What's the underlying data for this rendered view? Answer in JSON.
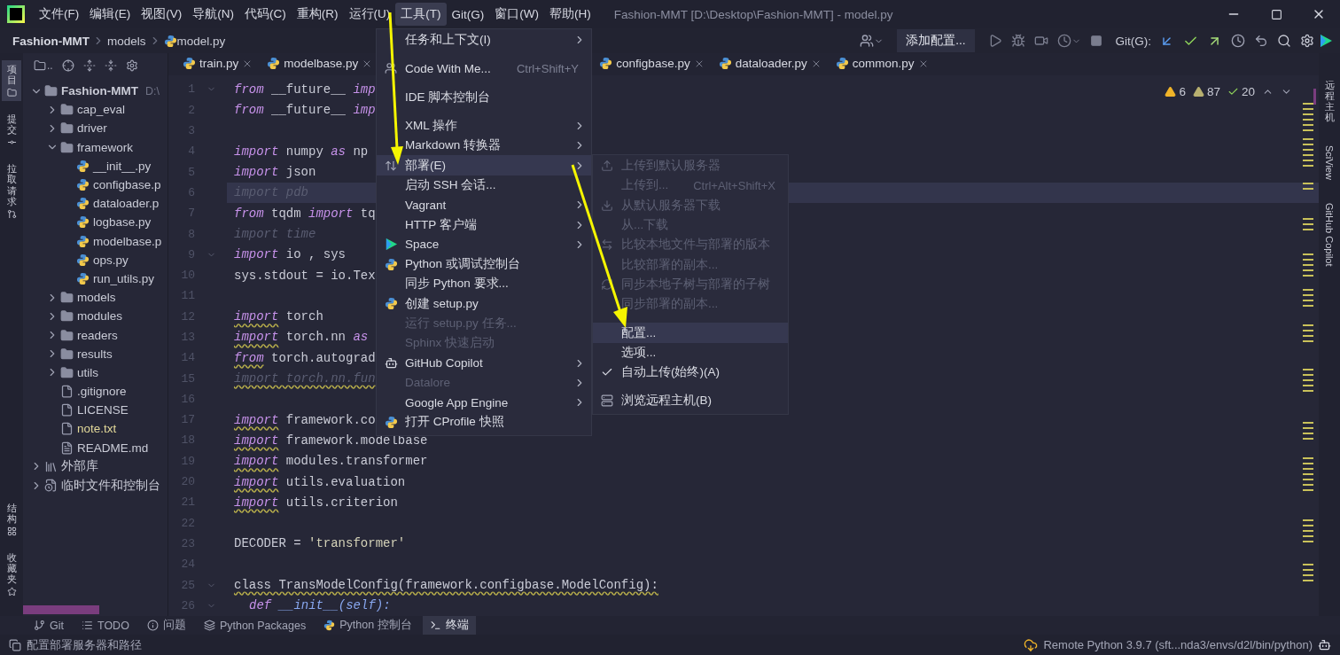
{
  "window": {
    "title": "Fashion-MMT [D:\\Desktop\\Fashion-MMT] - model.py"
  },
  "menubar": [
    {
      "label": "文件(F)",
      "selected": false
    },
    {
      "label": "编辑(E)",
      "selected": false
    },
    {
      "label": "视图(V)",
      "selected": false
    },
    {
      "label": "导航(N)",
      "selected": false
    },
    {
      "label": "代码(C)",
      "selected": false
    },
    {
      "label": "重构(R)",
      "selected": false
    },
    {
      "label": "运行(U)",
      "selected": false
    },
    {
      "label": "工具(T)",
      "selected": true
    },
    {
      "label": "Git(G)",
      "selected": false
    },
    {
      "label": "窗口(W)",
      "selected": false
    },
    {
      "label": "帮助(H)",
      "selected": false
    }
  ],
  "breadcrumbs": [
    "Fashion-MMT",
    "models",
    "model.py"
  ],
  "toolbar": {
    "run_config": "添加配置...",
    "git_label": "Git(G):"
  },
  "left_stripe": [
    {
      "label": "项目",
      "selected": true
    },
    {
      "label": "提交",
      "selected": false
    },
    {
      "label": "拉取请求",
      "selected": false
    },
    {
      "label": "结构",
      "selected": false
    },
    {
      "label": "收藏夹",
      "selected": false
    }
  ],
  "right_stripe": [
    {
      "label": "远程主机"
    },
    {
      "label": "SciView"
    },
    {
      "label": "GitHub Copilot"
    }
  ],
  "project": {
    "view": "..",
    "tree": [
      {
        "label": "Fashion-MMT",
        "kind": "project",
        "hint": "D:\\",
        "expanded": true,
        "color": "#c9cbd6",
        "children": [
          {
            "label": "cap_eval",
            "kind": "folder",
            "expanded": false,
            "color": "#c9cbd6"
          },
          {
            "label": "driver",
            "kind": "folder",
            "expanded": false,
            "color": "#c9cbd6"
          },
          {
            "label": "framework",
            "kind": "folder",
            "expanded": true,
            "color": "#c9cbd6",
            "children": [
              {
                "label": "__init__.py",
                "kind": "python",
                "color": "#c9cbd6"
              },
              {
                "label": "configbase.p",
                "kind": "python",
                "color": "#c9cbd6"
              },
              {
                "label": "dataloader.p",
                "kind": "python",
                "color": "#c9cbd6"
              },
              {
                "label": "logbase.py",
                "kind": "python",
                "color": "#c9cbd6"
              },
              {
                "label": "modelbase.p",
                "kind": "python",
                "color": "#c9cbd6"
              },
              {
                "label": "ops.py",
                "kind": "python",
                "color": "#c9cbd6"
              },
              {
                "label": "run_utils.py",
                "kind": "python",
                "color": "#c9cbd6"
              }
            ]
          },
          {
            "label": "models",
            "kind": "folder",
            "expanded": false,
            "color": "#c9cbd6"
          },
          {
            "label": "modules",
            "kind": "folder",
            "expanded": false,
            "color": "#c9cbd6"
          },
          {
            "label": "readers",
            "kind": "folder",
            "expanded": false,
            "color": "#c9cbd6"
          },
          {
            "label": "results",
            "kind": "folder",
            "expanded": false,
            "color": "#c9cbd6"
          },
          {
            "label": "utils",
            "kind": "folder",
            "expanded": false,
            "color": "#c9cbd6"
          },
          {
            "label": ".gitignore",
            "kind": "file",
            "color": "#c9cbd6"
          },
          {
            "label": "LICENSE",
            "kind": "file",
            "color": "#c9cbd6"
          },
          {
            "label": "note.txt",
            "kind": "file",
            "color": "#e3d99a"
          },
          {
            "label": "README.md",
            "kind": "markdown",
            "color": "#c9cbd6"
          }
        ]
      },
      {
        "label": "外部库",
        "kind": "library",
        "expanded": false,
        "color": "#c9cbd6"
      },
      {
        "label": "临时文件和控制台",
        "kind": "scratch",
        "expanded": false,
        "color": "#c9cbd6"
      }
    ]
  },
  "tabs": [
    {
      "label": "train.py",
      "selected": false
    },
    {
      "label": "modelbase.py",
      "selected": false
    },
    {
      "label": "configbase.py",
      "selected": false
    },
    {
      "label": "dataloader.py",
      "selected": false
    },
    {
      "label": "common.py",
      "selected": false
    }
  ],
  "inspections": {
    "warnings": "6",
    "weak_warnings": "87",
    "typos": "20"
  },
  "code": [
    {
      "number": "1",
      "current": false,
      "fold_marker": true,
      "tokens": [
        {
          "text": "from",
          "kind": "keyword",
          "squiggle": false
        },
        {
          "text": "__future__",
          "kind": "name",
          "squiggle": false
        },
        {
          "text": "imp",
          "kind": "keyword",
          "squiggle": false
        }
      ]
    },
    {
      "number": "2",
      "current": false,
      "fold_marker": false,
      "tokens": [
        {
          "text": "from",
          "kind": "keyword",
          "squiggle": false
        },
        {
          "text": "__future__",
          "kind": "name",
          "squiggle": false
        },
        {
          "text": "imp",
          "kind": "keyword",
          "squiggle": false
        }
      ]
    },
    {
      "number": "3",
      "current": false,
      "fold_marker": false
    },
    {
      "number": "4",
      "current": false,
      "fold_marker": false,
      "tokens": [
        {
          "text": "import",
          "kind": "keyword",
          "squiggle": false
        },
        {
          "text": "numpy",
          "kind": "name",
          "squiggle": false
        },
        {
          "text": "as",
          "kind": "keyword",
          "squiggle": false
        },
        {
          "text": "np",
          "kind": "name",
          "squiggle": false
        }
      ]
    },
    {
      "number": "5",
      "current": false,
      "fold_marker": false,
      "tokens": [
        {
          "text": "import",
          "kind": "keyword",
          "squiggle": false
        },
        {
          "text": "json",
          "kind": "name",
          "squiggle": false
        }
      ]
    },
    {
      "number": "6",
      "current": true,
      "fold_marker": false,
      "tokens": [
        {
          "text": "import pdb",
          "kind": "unused",
          "squiggle": false
        }
      ]
    },
    {
      "number": "7",
      "current": false,
      "fold_marker": false,
      "tokens": [
        {
          "text": "from",
          "kind": "keyword",
          "squiggle": false
        },
        {
          "text": "tqdm",
          "kind": "name",
          "squiggle": false
        },
        {
          "text": "import",
          "kind": "keyword",
          "squiggle": false
        },
        {
          "text": "tq",
          "kind": "name",
          "squiggle": false
        }
      ]
    },
    {
      "number": "8",
      "current": false,
      "fold_marker": false,
      "tokens": [
        {
          "text": "import time",
          "kind": "unused",
          "squiggle": false
        }
      ]
    },
    {
      "number": "9",
      "current": false,
      "fold_marker": true,
      "tokens": [
        {
          "text": "import",
          "kind": "keyword",
          "squiggle": false
        },
        {
          "text": "io , sys",
          "kind": "name",
          "squiggle": false
        }
      ]
    },
    {
      "number": "10",
      "current": false,
      "fold_marker": false,
      "tokens": [
        {
          "text": "sys.stdout = io.Tex",
          "kind": "name",
          "squiggle": false
        }
      ]
    },
    {
      "number": "11",
      "current": false,
      "fold_marker": false
    },
    {
      "number": "12",
      "current": false,
      "fold_marker": false,
      "tokens": [
        {
          "text": "import",
          "kind": "keyword",
          "squiggle": true
        },
        {
          "text": "torch",
          "kind": "name",
          "squiggle": false
        }
      ]
    },
    {
      "number": "13",
      "current": false,
      "fold_marker": false,
      "tokens": [
        {
          "text": "import",
          "kind": "keyword",
          "squiggle": true
        },
        {
          "text": "torch.nn",
          "kind": "name",
          "squiggle": false
        },
        {
          "text": "as",
          "kind": "keyword",
          "squiggle": false
        }
      ]
    },
    {
      "number": "14",
      "current": false,
      "fold_marker": false,
      "tokens": [
        {
          "text": "from",
          "kind": "keyword",
          "squiggle": true
        },
        {
          "text": "torch.autograd",
          "kind": "name",
          "squiggle": false
        }
      ]
    },
    {
      "number": "15",
      "current": false,
      "fold_marker": false,
      "tokens": [
        {
          "text": "import torch.nn.fun",
          "kind": "unused",
          "squiggle": true
        }
      ]
    },
    {
      "number": "16",
      "current": false,
      "fold_marker": false
    },
    {
      "number": "17",
      "current": false,
      "fold_marker": false,
      "tokens": [
        {
          "text": "import",
          "kind": "keyword",
          "squiggle": true
        },
        {
          "text": "framework.co",
          "kind": "name",
          "squiggle": false
        }
      ]
    },
    {
      "number": "18",
      "current": false,
      "fold_marker": false,
      "tokens": [
        {
          "text": "import",
          "kind": "keyword",
          "squiggle": true
        },
        {
          "text": "framework.modelbase",
          "kind": "name",
          "squiggle": false
        }
      ]
    },
    {
      "number": "19",
      "current": false,
      "fold_marker": false,
      "tokens": [
        {
          "text": "import",
          "kind": "keyword",
          "squiggle": true
        },
        {
          "text": "modules.transformer",
          "kind": "name",
          "squiggle": false
        }
      ]
    },
    {
      "number": "20",
      "current": false,
      "fold_marker": false,
      "tokens": [
        {
          "text": "import",
          "kind": "keyword",
          "squiggle": true
        },
        {
          "text": "utils.evaluation",
          "kind": "name",
          "squiggle": false
        }
      ]
    },
    {
      "number": "21",
      "current": false,
      "fold_marker": false,
      "tokens": [
        {
          "text": "import",
          "kind": "keyword",
          "squiggle": true
        },
        {
          "text": "utils.criterion",
          "kind": "name",
          "squiggle": false
        }
      ]
    },
    {
      "number": "22",
      "current": false,
      "fold_marker": false
    },
    {
      "number": "23",
      "current": false,
      "fold_marker": false,
      "tokens": [
        {
          "text": "DECODER =",
          "kind": "name",
          "squiggle": false
        },
        {
          "text": "'transformer'",
          "kind": "string",
          "squiggle": false
        }
      ]
    },
    {
      "number": "24",
      "current": false,
      "fold_marker": false
    },
    {
      "number": "25",
      "current": false,
      "fold_marker": true,
      "tokens": [
        {
          "text": "class TransModelConfig(framework.configbase.ModelConfig):",
          "kind": "name",
          "squiggle": true
        }
      ],
      "children": [
        {
          "number": "26",
          "current": false,
          "fold_marker": true,
          "tokens": [
            {
              "text": "def",
              "kind": "keyword",
              "squiggle": false
            },
            {
              "text": "__init__(self):",
              "kind": "call",
              "squiggle": false
            }
          ]
        }
      ]
    }
  ],
  "menu": [
    {
      "kind": "item",
      "label": "任务和上下文(I)",
      "submenu": true,
      "disabled": false,
      "selected": false
    },
    {
      "kind": "separator"
    },
    {
      "kind": "item",
      "label": "Code With Me...",
      "shortcut": "Ctrl+Shift+Y",
      "submenu": false,
      "disabled": false,
      "selected": false
    },
    {
      "kind": "separator"
    },
    {
      "kind": "item",
      "label": "IDE 脚本控制台",
      "submenu": false,
      "disabled": false,
      "selected": false
    },
    {
      "kind": "separator"
    },
    {
      "kind": "item",
      "label": "XML 操作",
      "submenu": true,
      "disabled": false,
      "selected": false
    },
    {
      "kind": "item",
      "label": "Markdown 转换器",
      "submenu": true,
      "disabled": false,
      "selected": false
    },
    {
      "kind": "item",
      "label": "部署(E)",
      "submenu": true,
      "disabled": false,
      "selected": true
    },
    {
      "kind": "item",
      "label": "启动 SSH 会话...",
      "submenu": false,
      "disabled": false,
      "selected": false
    },
    {
      "kind": "item",
      "label": "Vagrant",
      "submenu": true,
      "disabled": false,
      "selected": false
    },
    {
      "kind": "item",
      "label": "HTTP 客户端",
      "submenu": true,
      "disabled": false,
      "selected": false
    },
    {
      "kind": "item",
      "label": "Space",
      "submenu": true,
      "disabled": false,
      "selected": false
    },
    {
      "kind": "item",
      "label": "Python 或调试控制台",
      "submenu": false,
      "disabled": false,
      "selected": false
    },
    {
      "kind": "item",
      "label": "同步 Python 要求...",
      "submenu": false,
      "disabled": false,
      "selected": false
    },
    {
      "kind": "item",
      "label": "创建 setup.py",
      "submenu": false,
      "disabled": false,
      "selected": false
    },
    {
      "kind": "item",
      "label": "运行 setup.py 任务...",
      "submenu": false,
      "disabled": true,
      "selected": false
    },
    {
      "kind": "item",
      "label": "Sphinx 快速启动",
      "submenu": false,
      "disabled": true,
      "selected": false
    },
    {
      "kind": "item",
      "label": "GitHub Copilot",
      "submenu": true,
      "disabled": false,
      "selected": false
    },
    {
      "kind": "item",
      "label": "Datalore",
      "submenu": true,
      "disabled": true,
      "selected": false
    },
    {
      "kind": "item",
      "label": "Google App Engine",
      "submenu": true,
      "disabled": false,
      "selected": false
    },
    {
      "kind": "item",
      "label": "打开 CProfile 快照",
      "submenu": false,
      "disabled": false,
      "selected": false
    }
  ],
  "submenu": [
    {
      "kind": "item",
      "label": "上传到默认服务器",
      "disabled": true,
      "selected": false,
      "checked": false
    },
    {
      "kind": "item",
      "label": "上传到...",
      "shortcut": "Ctrl+Alt+Shift+X",
      "disabled": true,
      "selected": false,
      "checked": false
    },
    {
      "kind": "item",
      "label": "从默认服务器下载",
      "disabled": true,
      "selected": false,
      "checked": false
    },
    {
      "kind": "item",
      "label": "从...下载",
      "disabled": true,
      "selected": false,
      "checked": false
    },
    {
      "kind": "item",
      "label": "比较本地文件与部署的版本",
      "disabled": true,
      "selected": false,
      "checked": false
    },
    {
      "kind": "item",
      "label": "比较部署的副本...",
      "disabled": true,
      "selected": false,
      "checked": false
    },
    {
      "kind": "item",
      "label": "同步本地子树与部署的子树",
      "disabled": true,
      "selected": false,
      "checked": false
    },
    {
      "kind": "item",
      "label": "同步部署的副本...",
      "disabled": true,
      "selected": false,
      "checked": false
    },
    {
      "kind": "separator"
    },
    {
      "kind": "item",
      "label": "配置...",
      "disabled": false,
      "selected": true,
      "checked": false
    },
    {
      "kind": "item",
      "label": "选项...",
      "disabled": false,
      "selected": false,
      "checked": false
    },
    {
      "kind": "item",
      "label": "自动上传(始终)(A)",
      "disabled": false,
      "selected": false,
      "checked": true
    },
    {
      "kind": "separator"
    },
    {
      "kind": "item",
      "label": "浏览远程主机(B)",
      "disabled": false,
      "selected": false,
      "checked": false
    }
  ],
  "tool_windows": [
    {
      "label": "Git",
      "selected": false
    },
    {
      "label": "TODO",
      "selected": false
    },
    {
      "label": "问题",
      "selected": false
    },
    {
      "label": "Python Packages",
      "selected": false
    },
    {
      "label": "Python 控制台",
      "selected": false
    },
    {
      "label": "终端",
      "selected": true
    }
  ],
  "status_bar": {
    "message": "配置部署服务器和路径",
    "interpreter": "Remote Python 3.9.7 (sft...nda3/envs/d2l/bin/python)"
  }
}
